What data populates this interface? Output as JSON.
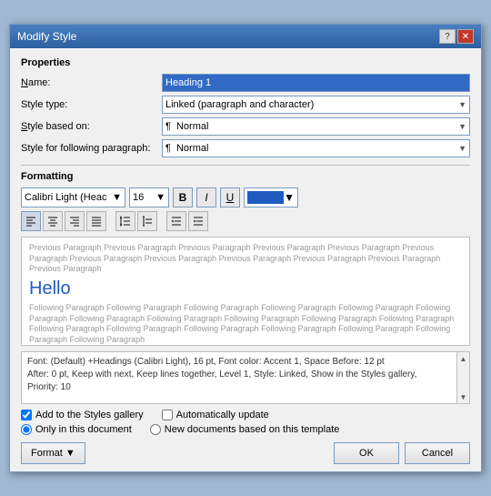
{
  "dialog": {
    "title": "Modify Style",
    "help_btn": "?",
    "close_btn": "✕"
  },
  "properties": {
    "section_label": "Properties",
    "name_label": "Name:",
    "name_underline": "N",
    "name_value": "Heading 1",
    "style_type_label": "Style type:",
    "style_type_value": "Linked (paragraph and character)",
    "style_based_label": "Style based on:",
    "style_based_value": "Normal",
    "style_following_label": "Style for following paragraph:",
    "style_following_value": "Normal"
  },
  "formatting": {
    "section_label": "Formatting",
    "font_name": "Calibri Light (Heac",
    "font_size": "16",
    "bold_label": "B",
    "italic_label": "I",
    "underline_label": "U",
    "color_label": ""
  },
  "alignment": {
    "buttons": [
      "left_top",
      "center_top",
      "right_top",
      "justify_top",
      "left_mid",
      "center_mid",
      "justify_mid",
      "line_spacing",
      "para_spacing",
      "indent_dec",
      "indent_inc"
    ]
  },
  "preview": {
    "previous_text": "Previous Paragraph Previous Paragraph Previous Paragraph Previous Paragraph Previous Paragraph Previous Paragraph Previous Paragraph Previous Paragraph Previous Paragraph Previous Paragraph Previous Paragraph Previous Paragraph",
    "heading_text": "Hello",
    "following_text": "Following Paragraph Following Paragraph Following Paragraph Following Paragraph Following Paragraph Following Paragraph Following Paragraph Following Paragraph Following Paragraph Following Paragraph Following Paragraph Following Paragraph Following Paragraph Following Paragraph Following Paragraph Following Paragraph Following Paragraph Following Paragraph"
  },
  "description": {
    "text": "Font: (Default) +Headings (Calibri Light), 16 pt, Font color: Accent 1, Space Before: 12 pt\n      After: 0 pt, Keep with next, Keep lines together, Level 1, Style: Linked, Show in the Styles gallery, Priority: 10"
  },
  "options": {
    "add_to_gallery_label": "Add to the Styles gallery",
    "add_to_gallery_checked": true,
    "auto_update_label": "Automatically update",
    "auto_update_checked": false,
    "only_in_doc_label": "Only in this document",
    "only_in_doc_selected": true,
    "new_docs_label": "New documents based on this template",
    "new_docs_selected": false
  },
  "buttons": {
    "format_label": "Format",
    "format_arrow": "▼",
    "ok_label": "OK",
    "cancel_label": "Cancel"
  }
}
